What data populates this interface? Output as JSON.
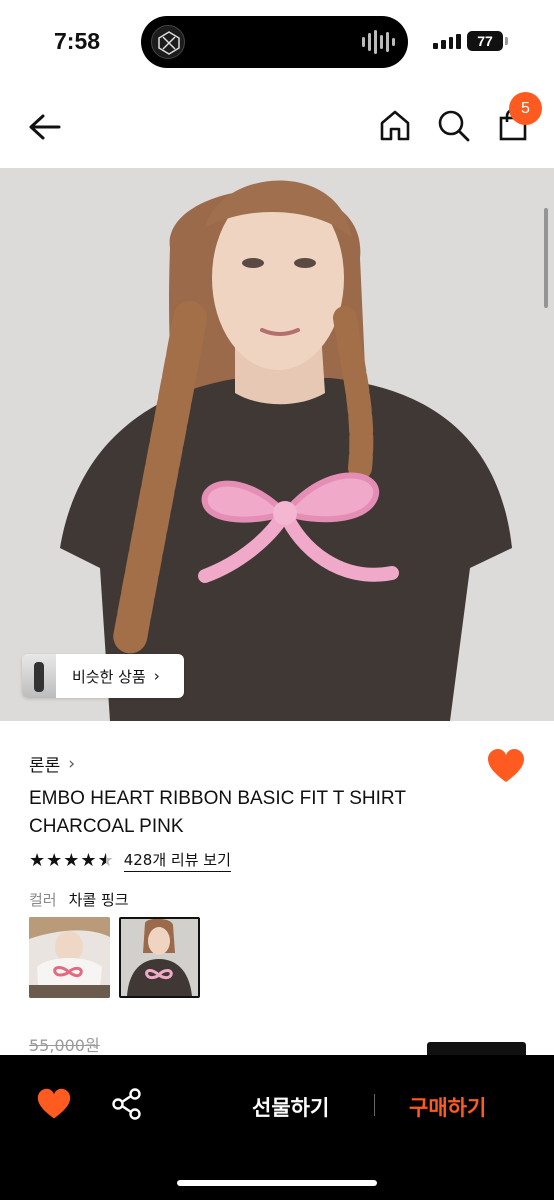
{
  "status_bar": {
    "time": "7:58",
    "battery": "77"
  },
  "nav": {
    "back_icon": "arrow-left-icon",
    "home_icon": "home-icon",
    "search_icon": "search-icon",
    "bag_icon": "shopping-bag-icon",
    "cart_count": "5"
  },
  "hero": {
    "similar_label": "비슷한 상품",
    "similar_chevron": "›"
  },
  "product": {
    "brand": "론론",
    "brand_chevron": "›",
    "title": "EMBO HEART RIBBON BASIC FIT T SHIRT CHARCOAL PINK",
    "rating": 4.5,
    "review_link": "428개 리뷰 보기",
    "color_label": "컬러",
    "color_value": "차콜 핑크",
    "color_options": [
      "white-pink",
      "charcoal-pink"
    ],
    "selected_color_index": 1,
    "original_price": "55,000원"
  },
  "bottom_bar": {
    "gift_label": "선물하기",
    "buy_label": "구매하기"
  },
  "colors": {
    "accent": "#ff5a1f",
    "wish_heart": "#ff5a1f",
    "bar_background": "#000000"
  }
}
